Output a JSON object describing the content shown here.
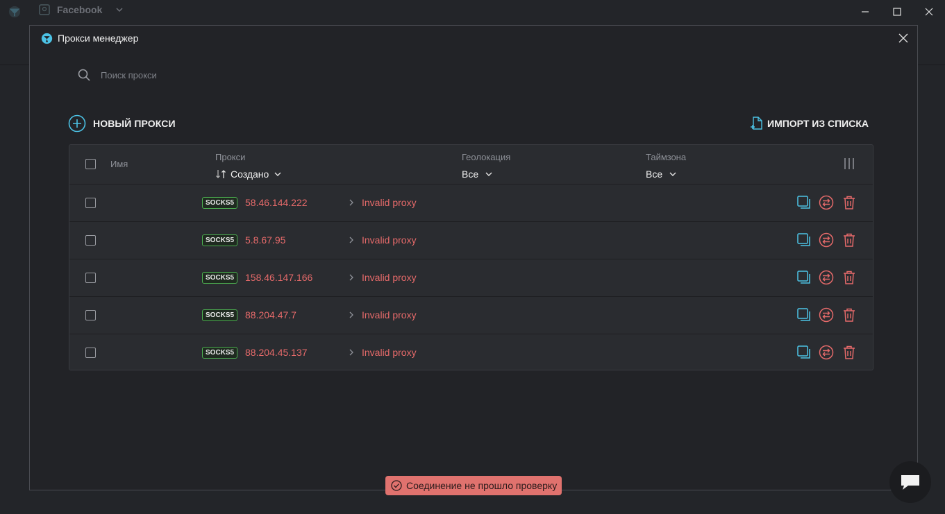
{
  "app": {
    "tab_name": "Facebook",
    "accent": "#4cc3e6"
  },
  "modal": {
    "title": "Прокси менеджер",
    "search_placeholder": "Поиск прокси",
    "new_proxy_label": "НОВЫЙ ПРОКСИ",
    "import_label": "ИМПОРТ ИЗ СПИСКА"
  },
  "table": {
    "columns": {
      "name": "Имя",
      "proxy": "Прокси",
      "sort_label": "Создано",
      "geo": "Геолокация",
      "geo_filter": "Все",
      "timezone": "Таймзона",
      "timezone_filter": "Все"
    },
    "rows": [
      {
        "type": "SOCKS5",
        "ip": "58.46.144.222",
        "status": "Invalid proxy"
      },
      {
        "type": "SOCKS5",
        "ip": "5.8.67.95",
        "status": "Invalid proxy"
      },
      {
        "type": "SOCKS5",
        "ip": "158.46.147.166",
        "status": "Invalid proxy"
      },
      {
        "type": "SOCKS5",
        "ip": "88.204.47.7",
        "status": "Invalid proxy"
      },
      {
        "type": "SOCKS5",
        "ip": "88.204.45.137",
        "status": "Invalid proxy"
      }
    ]
  },
  "toast": {
    "message": "Соединение не прошло проверку",
    "color": "#e0726e"
  },
  "colors": {
    "error": "#e66a6a",
    "badge_border": "#4caf50"
  }
}
